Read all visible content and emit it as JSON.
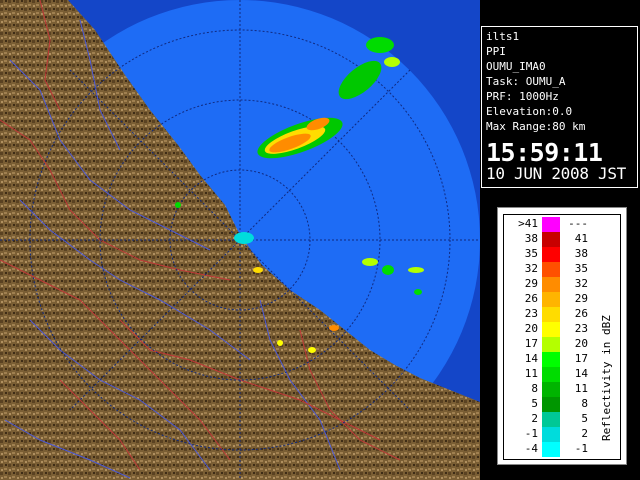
{
  "info": {
    "site": "ilts1",
    "mode": "PPI",
    "product": "OUMU_IMA0",
    "task": "Task: OUMU_A",
    "prf": "PRF: 1000Hz",
    "elevation": "Elevation:0.0",
    "max_range": "Max Range:80 km",
    "time": "15:59:11",
    "date": "10 JUN 2008 JST"
  },
  "legend": {
    "title": "Reflectivity in dBZ",
    "rows": [
      {
        "lo": ">41",
        "hi": "---",
        "color": "#ff00ff"
      },
      {
        "lo": "38",
        "hi": "41",
        "color": "#c80000"
      },
      {
        "lo": "35",
        "hi": "38",
        "color": "#ff0000"
      },
      {
        "lo": "32",
        "hi": "35",
        "color": "#ff5000"
      },
      {
        "lo": "29",
        "hi": "32",
        "color": "#ff8c00"
      },
      {
        "lo": "26",
        "hi": "29",
        "color": "#ffb400"
      },
      {
        "lo": "23",
        "hi": "26",
        "color": "#ffdc00"
      },
      {
        "lo": "20",
        "hi": "23",
        "color": "#ffff00"
      },
      {
        "lo": "17",
        "hi": "20",
        "color": "#b4ff00"
      },
      {
        "lo": "14",
        "hi": "17",
        "color": "#00ff00"
      },
      {
        "lo": "11",
        "hi": "14",
        "color": "#00dc00"
      },
      {
        "lo": "8",
        "hi": "11",
        "color": "#00b400"
      },
      {
        "lo": "5",
        "hi": "8",
        "color": "#009600"
      },
      {
        "lo": "2",
        "hi": "5",
        "color": "#00c896"
      },
      {
        "lo": "-1",
        "hi": "2",
        "color": "#00dcdc"
      },
      {
        "lo": "-4",
        "hi": "-1",
        "color": "#00ffff"
      }
    ]
  },
  "colors": {
    "sea": "#1e6cf5",
    "sea_outer": "#1446c8",
    "land": "#7a5e34",
    "rivers": "#4c5ad8",
    "boundaries": "#c03838",
    "range_rings": "#102a80"
  }
}
